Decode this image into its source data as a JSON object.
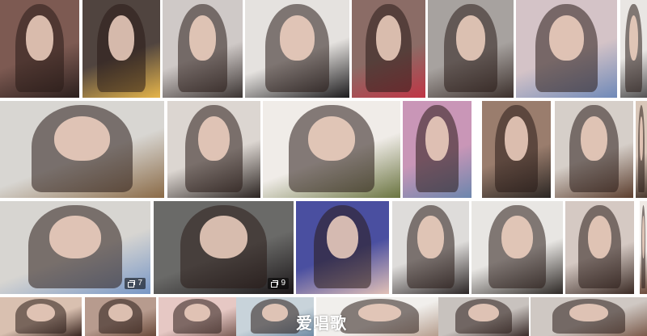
{
  "gallery": {
    "rows": [
      {
        "tiles": [
          {
            "palette": [
              "#7d5a52",
              "#2b1f1d"
            ]
          },
          {
            "palette": [
              "#50443f",
              "#e6b54a"
            ]
          },
          {
            "palette": [
              "#cfc9c7",
              "#3b3432"
            ]
          },
          {
            "palette": [
              "#e5e2df",
              "#1c1b1d"
            ]
          },
          {
            "palette": [
              "#8b6c66",
              "#c03545"
            ]
          },
          {
            "palette": [
              "#a7a29f",
              "#3b2f2b"
            ]
          },
          {
            "palette": [
              "#d4c3c7",
              "#6f89b8"
            ]
          },
          {
            "palette": [
              "#e9e6e3",
              "#545354"
            ]
          }
        ]
      },
      {
        "tiles": [
          {
            "palette": [
              "#d8d6d2",
              "#8a6a46"
            ]
          },
          {
            "palette": [
              "#dcd6d1",
              "#2b2421"
            ]
          },
          {
            "palette": [
              "#f0ece8",
              "#6a7440"
            ]
          },
          {
            "palette": [
              "#c996b7",
              "#6c86ad"
            ]
          },
          {
            "palette": [
              "#9a7d6d",
              "#2b2623"
            ]
          },
          {
            "palette": [
              "#d6cfc9",
              "#5b3d2d"
            ]
          },
          {
            "palette": [
              "#d9c7b9",
              "#4b3a30"
            ]
          }
        ]
      },
      {
        "tiles": [
          {
            "palette": [
              "#d7d5d1",
              "#7897c6"
            ],
            "badge": "7"
          },
          {
            "palette": [
              "#6a6a68",
              "#1a1618"
            ],
            "badge": "9"
          },
          {
            "palette": [
              "#4a4fa0",
              "#e2c1b7"
            ]
          },
          {
            "palette": [
              "#dedcda",
              "#2c2626"
            ]
          },
          {
            "palette": [
              "#e8e6e3",
              "#2e2926"
            ]
          },
          {
            "palette": [
              "#d5c9c3",
              "#3a2a24"
            ]
          },
          {
            "palette": [
              "#efe9e4",
              "#6a4a3a"
            ]
          }
        ]
      },
      {
        "tiles": [
          {
            "palette": [
              "#d9c0b0",
              "#3a2620"
            ]
          },
          {
            "palette": [
              "#b79b8e",
              "#6a4a3a"
            ]
          },
          {
            "palette": [
              "#e6c8c4",
              "#7c5e57"
            ]
          },
          {
            "palette": [
              "#c8d3da",
              "#6e8aa3"
            ]
          },
          {
            "palette": [
              "#f1efec",
              "#b39a8a"
            ]
          },
          {
            "palette": [
              "#c8c2be",
              "#3a2c2a"
            ]
          },
          {
            "palette": [
              "#cfc8c3",
              "#7a5a4a"
            ]
          }
        ]
      }
    ],
    "watermark": "爱唱歌"
  }
}
